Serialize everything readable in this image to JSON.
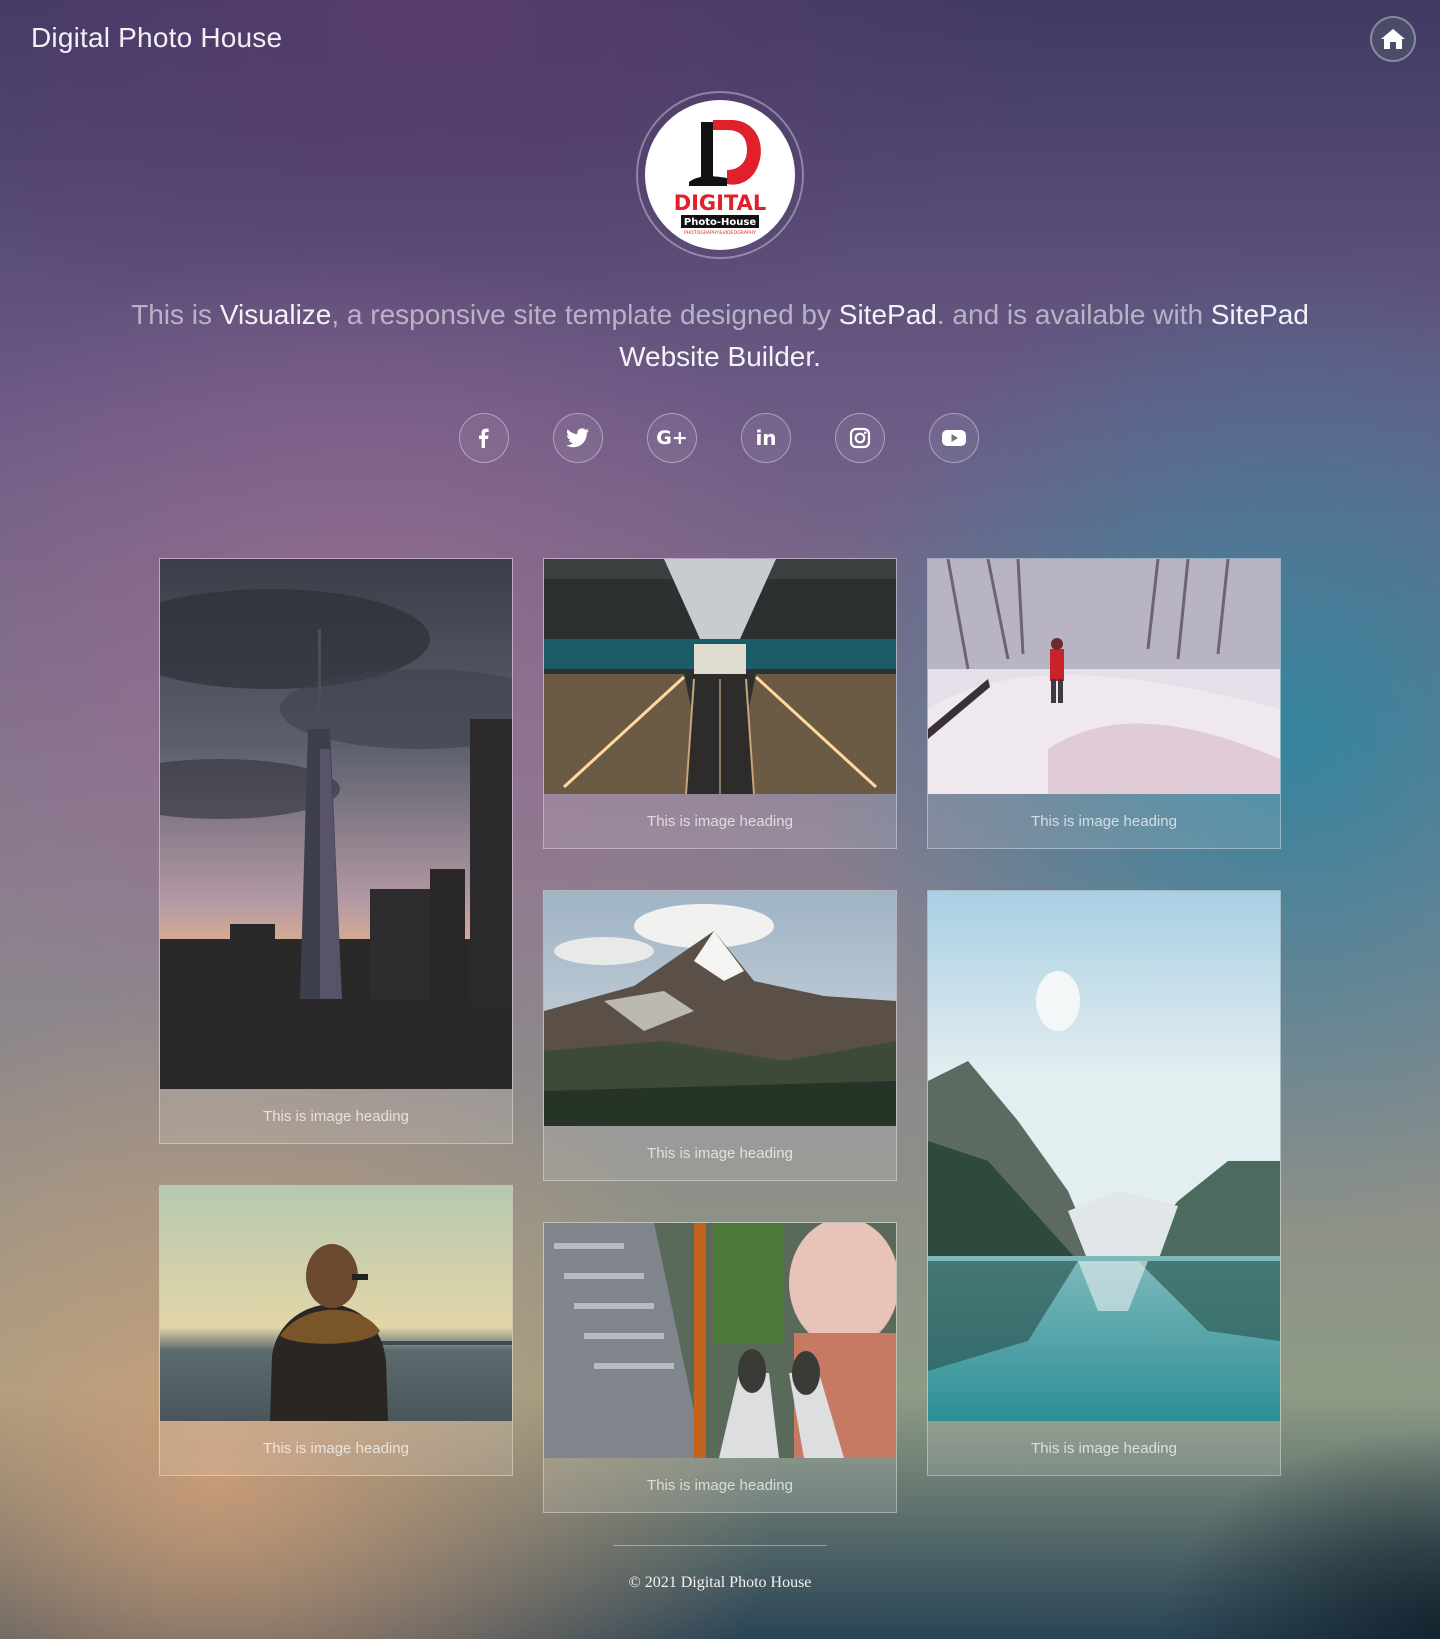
{
  "header": {
    "site_title": "Digital Photo House",
    "home_icon": "home-icon"
  },
  "logo": {
    "letter": "D",
    "brand": "DIGITAL",
    "subbrand": "Photo-House",
    "tagline": "PHOTOGRAPHY&VIDEOGRAPHY"
  },
  "intro": {
    "part1": "This is ",
    "visualize": "Visualize",
    "part2": ", a responsive site template designed by ",
    "sitepad": "SitePad",
    "part3": ". and is available with ",
    "builder": "SitePad Website Builder",
    "part4": "."
  },
  "socials": [
    {
      "name": "facebook-icon"
    },
    {
      "name": "twitter-icon"
    },
    {
      "name": "google-plus-icon",
      "label": "G+"
    },
    {
      "name": "linkedin-icon",
      "label": "in"
    },
    {
      "name": "instagram-icon"
    },
    {
      "name": "youtube-icon"
    }
  ],
  "gallery": {
    "cards": [
      {
        "caption": "This is image heading",
        "image": "city-skyline-sunset"
      },
      {
        "caption": "This is image heading",
        "image": "escalator-symmetry"
      },
      {
        "caption": "This is image heading",
        "image": "snowy-field-photographer"
      },
      {
        "caption": "This is image heading",
        "image": "snowy-mountain-peak"
      },
      {
        "caption": "This is image heading",
        "image": "mountain-lake-reflection"
      },
      {
        "caption": "This is image heading",
        "image": "person-at-seaside"
      },
      {
        "caption": "This is image heading",
        "image": "feet-over-skyscrapers"
      }
    ]
  },
  "footer": {
    "text": "© 2021 Digital Photo House"
  },
  "colors": {
    "logo_red": "#e0202a",
    "logo_black": "#111111"
  }
}
